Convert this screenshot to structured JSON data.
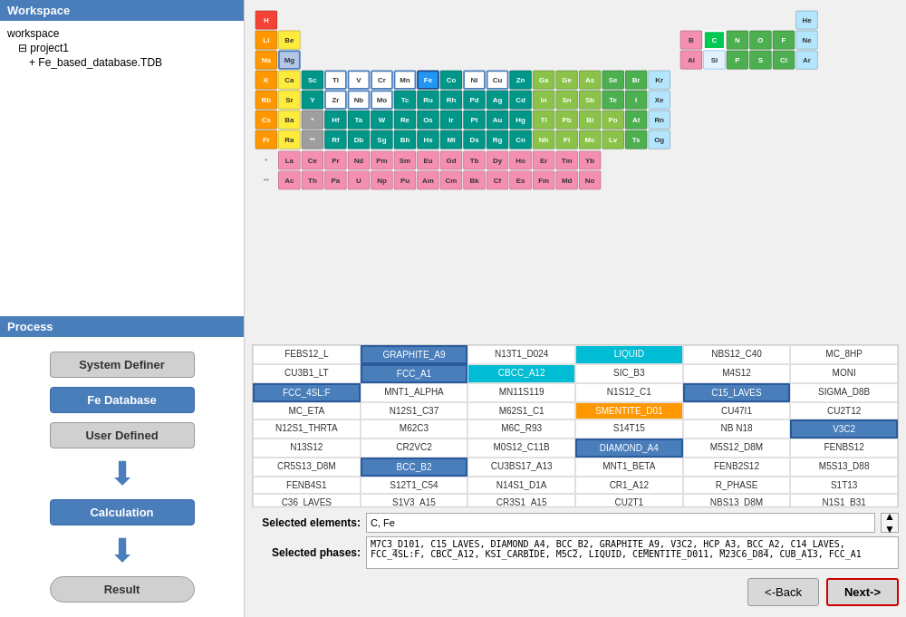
{
  "sidebar": {
    "workspace_header": "Workspace",
    "tree": [
      {
        "label": "workspace",
        "indent": 0
      },
      {
        "label": "⊟ project1",
        "indent": 1
      },
      {
        "label": "+ Fe_based_database.TDB",
        "indent": 2
      }
    ],
    "process_header": "Process",
    "system_definer_label": "System Definer",
    "fe_database_label": "Fe Database",
    "user_defined_label": "User Defined",
    "calculation_label": "Calculation",
    "result_label": "Result"
  },
  "periodic_table": {
    "note": "Periodic table with selected elements C and Fe highlighted"
  },
  "phases": {
    "cells": [
      {
        "label": "FEBS12_L",
        "type": "normal"
      },
      {
        "label": "GRAPHITE_A9",
        "type": "highlighted"
      },
      {
        "label": "N13T1_D024",
        "type": "normal"
      },
      {
        "label": "LIQUID",
        "type": "highlighted-cyan"
      },
      {
        "label": "NBS12_C40",
        "type": "normal"
      },
      {
        "label": "MC_8HP",
        "type": "normal"
      },
      {
        "label": "CU3B1_LT",
        "type": "normal"
      },
      {
        "label": "FCC_A1",
        "type": "highlighted"
      },
      {
        "label": "CBCC_A12",
        "type": "highlighted-cyan"
      },
      {
        "label": "SIC_B3",
        "type": "normal"
      },
      {
        "label": "M4S12",
        "type": "normal"
      },
      {
        "label": "MONI",
        "type": "normal"
      },
      {
        "label": "FCC_4SL:F",
        "type": "highlighted"
      },
      {
        "label": "MNT1_ALPHA",
        "type": "normal"
      },
      {
        "label": "MN11S119",
        "type": "normal"
      },
      {
        "label": "N1S12_C1",
        "type": "normal"
      },
      {
        "label": "C15_LAVES",
        "type": "highlighted"
      },
      {
        "label": "SIGMA_D8B",
        "type": "normal"
      },
      {
        "label": "MC_ETA",
        "type": "normal"
      },
      {
        "label": "N12S1_C37",
        "type": "normal"
      },
      {
        "label": "M62S1_C1",
        "type": "normal"
      },
      {
        "label": "SMENTITE_D01",
        "type": "highlighted-orange"
      },
      {
        "label": "CU47I1",
        "type": "normal"
      },
      {
        "label": "CU2T12",
        "type": "normal"
      },
      {
        "label": "N12S1_THRTA",
        "type": "normal"
      },
      {
        "label": "M62C3",
        "type": "normal"
      },
      {
        "label": "M6C_R93",
        "type": "normal"
      },
      {
        "label": "S14T15",
        "type": "normal"
      },
      {
        "label": "NB N18",
        "type": "normal"
      },
      {
        "label": "V3C2",
        "type": "highlighted"
      },
      {
        "label": "N13S12",
        "type": "normal"
      },
      {
        "label": "CR2VC2",
        "type": "normal"
      },
      {
        "label": "M0S12_C11B",
        "type": "normal"
      },
      {
        "label": "DIAMOND_A4",
        "type": "highlighted"
      },
      {
        "label": "M5S12_D8M",
        "type": "normal"
      },
      {
        "label": "FENBS12",
        "type": "normal"
      },
      {
        "label": "CR5S13_D8M",
        "type": "normal"
      },
      {
        "label": "BCC_B2",
        "type": "highlighted"
      },
      {
        "label": "CU3BS17_A13",
        "type": "normal"
      },
      {
        "label": "MNT1_BETA",
        "type": "normal"
      },
      {
        "label": "FENB2S12",
        "type": "normal"
      },
      {
        "label": "M5S13_D88",
        "type": "normal"
      },
      {
        "label": "FENB4S1",
        "type": "normal"
      },
      {
        "label": "S12T1_C54",
        "type": "normal"
      },
      {
        "label": "N14S1_D1A",
        "type": "normal"
      },
      {
        "label": "CR1_A12",
        "type": "normal"
      },
      {
        "label": "R_PHASE",
        "type": "normal"
      },
      {
        "label": "S1T13",
        "type": "normal"
      },
      {
        "label": "C36_LAVES",
        "type": "normal"
      },
      {
        "label": "S1V3_A15",
        "type": "normal"
      },
      {
        "label": "CR3S1_A15",
        "type": "normal"
      },
      {
        "label": "CU2T1",
        "type": "normal"
      },
      {
        "label": "NBS13_D8M",
        "type": "normal"
      },
      {
        "label": "N1S1_B31",
        "type": "normal"
      }
    ]
  },
  "selected_elements": {
    "label": "Selected elements:",
    "value": "C, Fe"
  },
  "selected_phases": {
    "label": "Selected phases:",
    "value": "M7C3_D101, C15_LAVES, DIAMOND_A4, BCC_B2, GRAPHITE_A9, V3C2, HCP_A3, BCC_A2, C14_LAVES, FCC_4SL:F, CBCC_A12, KSI_CARBIDE, M5C2, LIQUID, CEMENTITE_D011, M23C6_D84, CUB_A13, FCC_A1"
  },
  "buttons": {
    "back": "<-Back",
    "next": "Next->"
  }
}
